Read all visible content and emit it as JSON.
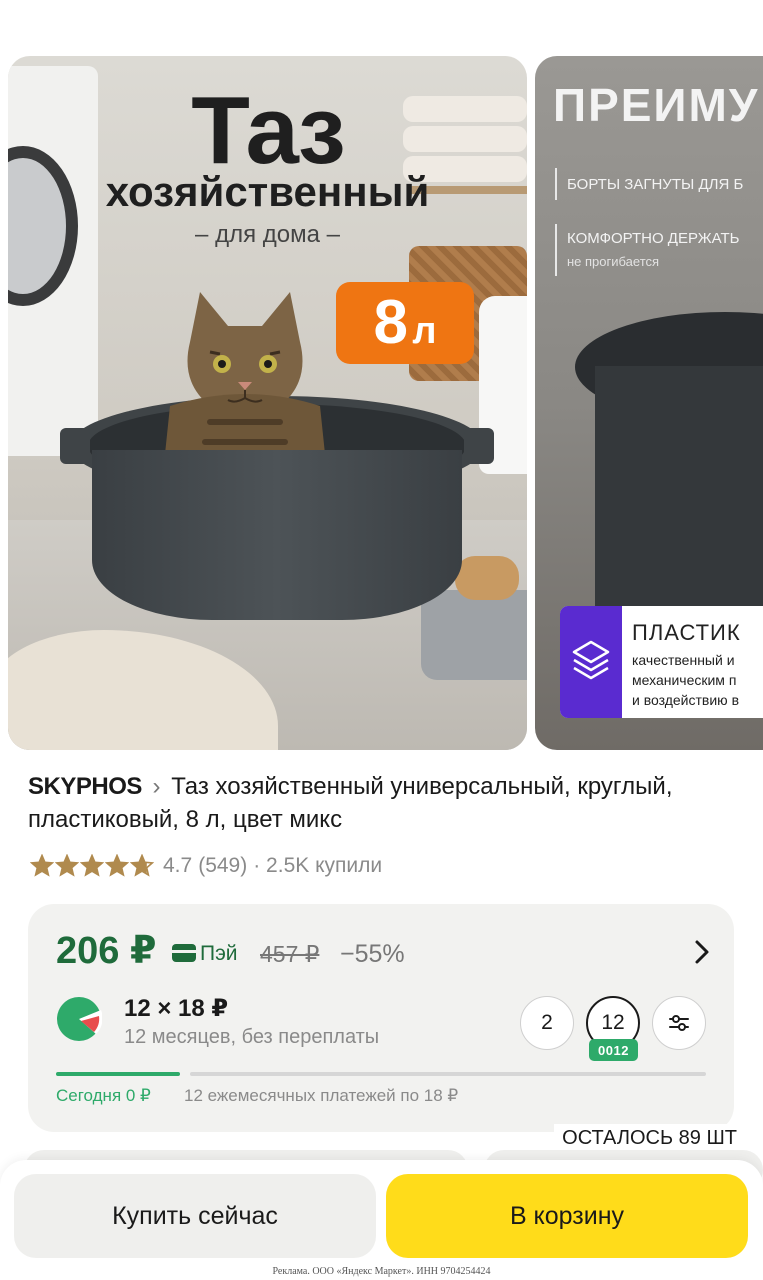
{
  "gallery": {
    "slide1": {
      "title_big": "Таз",
      "title_mid": "хозяйственный",
      "title_small": "– для дома –",
      "badge_number": "8",
      "badge_unit": "л"
    },
    "slide2": {
      "title": "ПРЕИМУ",
      "line1": "БОРТЫ ЗАГНУТЫ ДЛЯ Б",
      "line2": "КОМФОРТНО ДЕРЖАТЬ",
      "line2_sub": "не прогибается",
      "card_title": "ПЛАСТИК",
      "card_line1": "качественный и",
      "card_line2": "механическим п",
      "card_line3": "и воздействию в"
    }
  },
  "product": {
    "brand": "SKYPHOS",
    "separator": "›",
    "title": "Таз хозяйственный универсальный, круглый, пластиковый, 8 л, цвет микс",
    "rating": "4.7",
    "reviews": "(549)",
    "purchases": "· 2.5K купили",
    "stars_value": 4.7,
    "stars_max": 5
  },
  "price": {
    "current": "206 ₽",
    "pay_label": "Пэй",
    "old": "457 ₽",
    "discount": "−55%"
  },
  "installment": {
    "amount": "12 × 18 ₽",
    "description": "12 месяцев, без переплаты",
    "options": [
      "2",
      "12"
    ],
    "selected_code": "0012",
    "today": "Сегодня 0 ₽",
    "schedule": "12 ежемесячных платежей по 18 ₽",
    "progress_paid_fraction": 0.19
  },
  "stock": {
    "label": "ОСТАЛОСЬ 89 ШТ"
  },
  "actions": {
    "buy_now": "Купить сейчас",
    "add_to_cart": "В корзину"
  },
  "ad_note": "Реклама. ООО «Яндекс Маркет». ИНН 9704254424",
  "colors": {
    "price_green": "#1f6b3b",
    "accent_green": "#2eaa6a",
    "cart_yellow": "#ffdc1a",
    "badge_orange": "#ef7512",
    "star_gold": "#b08a4e"
  },
  "icons": {
    "chevron": "chevron-right-icon",
    "pay": "card-icon",
    "split": "split-logo-icon",
    "settings": "sliders-icon",
    "star": "star-icon"
  }
}
